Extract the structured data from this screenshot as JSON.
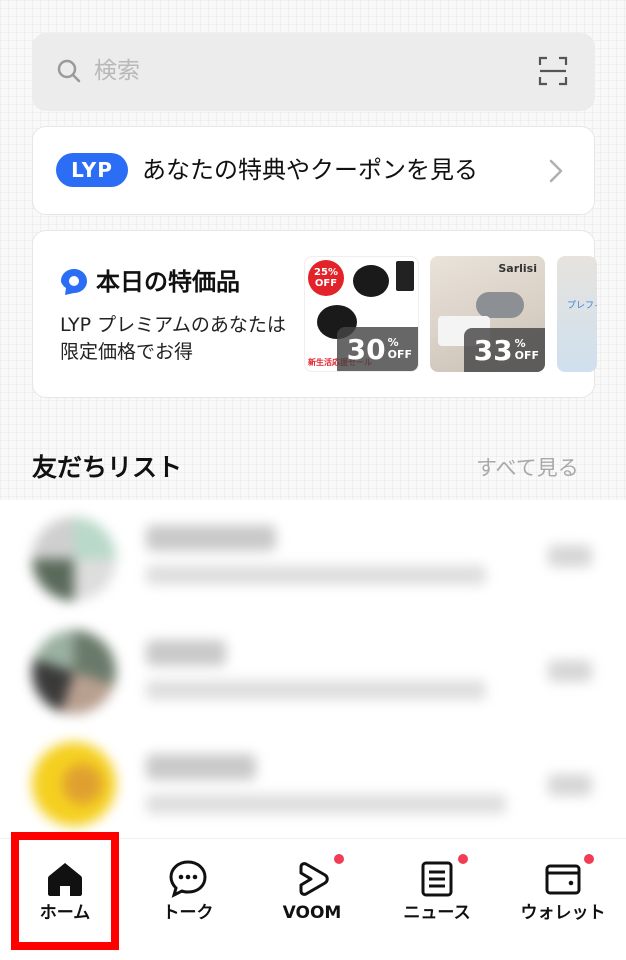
{
  "search": {
    "placeholder": "検索"
  },
  "lyp_banner": {
    "logo": "LYP",
    "text": "あなたの特典やクーポンを見る"
  },
  "deals": {
    "title": "本日の特価品",
    "description": "LYP プレミアムのあなたは限定価格でお得",
    "items": [
      {
        "discount": "30",
        "percent": "%",
        "off": "OFF",
        "badge_top": "25%",
        "badge_bottom": "OFF",
        "tag": "新生活応援セール"
      },
      {
        "discount": "33",
        "percent": "%",
        "off": "OFF",
        "brand": "Sarlisi"
      },
      {
        "label": "プレフィ"
      }
    ]
  },
  "friends": {
    "title": "友だちリスト",
    "see_all": "すべて見る"
  },
  "tabs": [
    {
      "label": "ホーム",
      "icon": "home-icon",
      "active": true,
      "badge": false
    },
    {
      "label": "トーク",
      "icon": "chat-bubble-icon",
      "badge": false
    },
    {
      "label": "VOOM",
      "icon": "voom-play-icon",
      "badge": true
    },
    {
      "label": "ニュース",
      "icon": "news-icon",
      "badge": true
    },
    {
      "label": "ウォレット",
      "icon": "wallet-icon",
      "badge": true
    }
  ],
  "colors": {
    "brand_blue": "#2b6ef5",
    "badge_red": "#f03c55",
    "highlight": "#ff0000"
  }
}
